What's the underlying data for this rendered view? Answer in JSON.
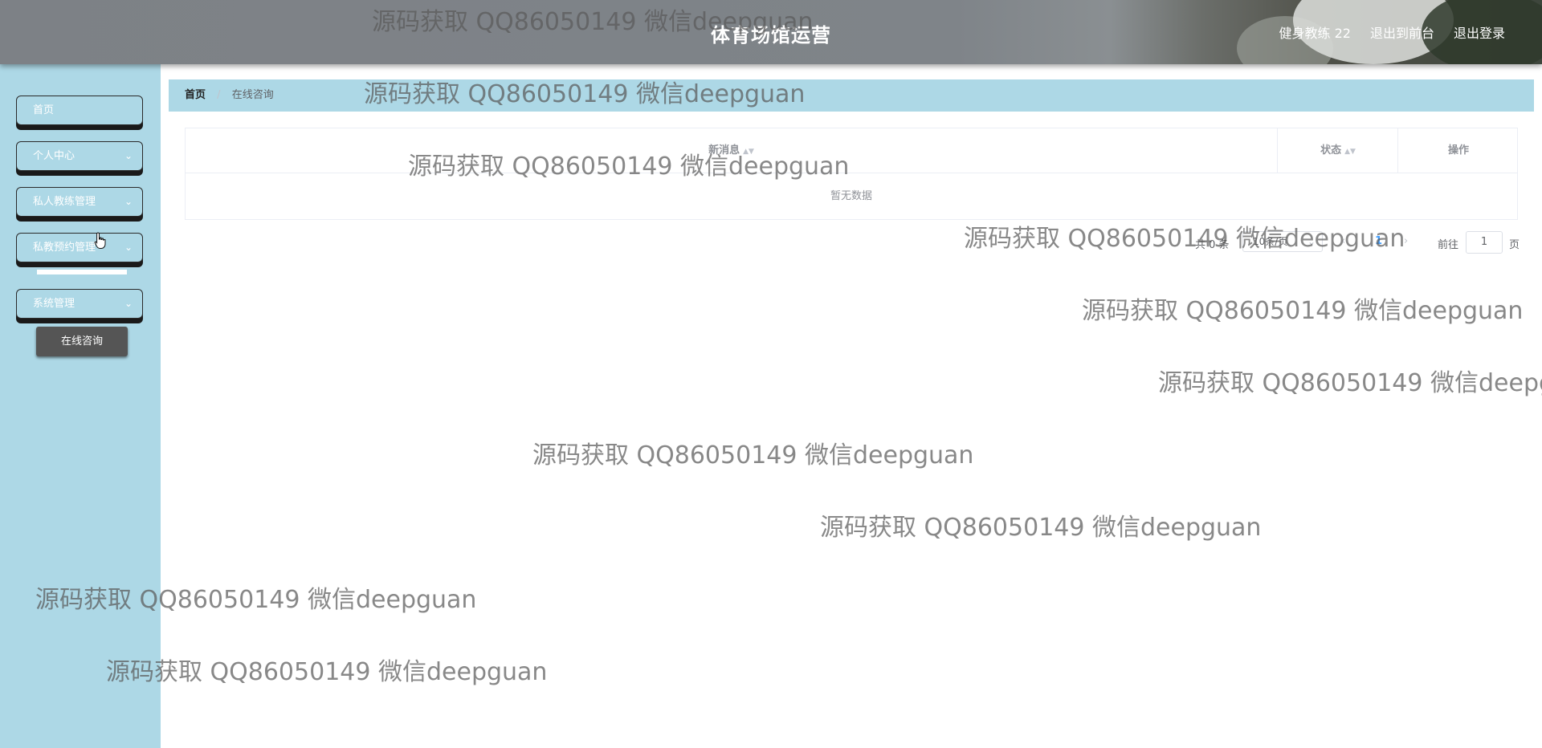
{
  "header": {
    "title": "体育场馆运营",
    "user": "健身教练 22",
    "to_front": "退出到前台",
    "logout": "退出登录"
  },
  "sidebar": {
    "items": [
      {
        "label": "首页",
        "has_chevron": false
      },
      {
        "label": "个人中心",
        "has_chevron": true
      },
      {
        "label": "私人教练管理",
        "has_chevron": true
      },
      {
        "label": "私教预约管理",
        "has_chevron": true
      },
      {
        "label": "系统管理",
        "has_chevron": true
      }
    ],
    "submenu_item": "在线咨询",
    "chevron_icon": "chevron-down-icon"
  },
  "breadcrumb": {
    "home": "首页",
    "separator": "/",
    "current": "在线咨询"
  },
  "table": {
    "columns": [
      "新消息",
      "状态",
      "操作"
    ],
    "empty_text": "暂无数据"
  },
  "pagination": {
    "total": "共 0 条",
    "page_size": "10条/页",
    "current_page": "1",
    "goto_label": "前往",
    "jump_value": "1",
    "page_unit": "页"
  },
  "watermark": "源码获取 QQ86050149 微信deepguan",
  "colors": {
    "sidebar_bg": "#add8e6",
    "header_bg": "#7d8186",
    "submenu_bg": "#555555"
  }
}
